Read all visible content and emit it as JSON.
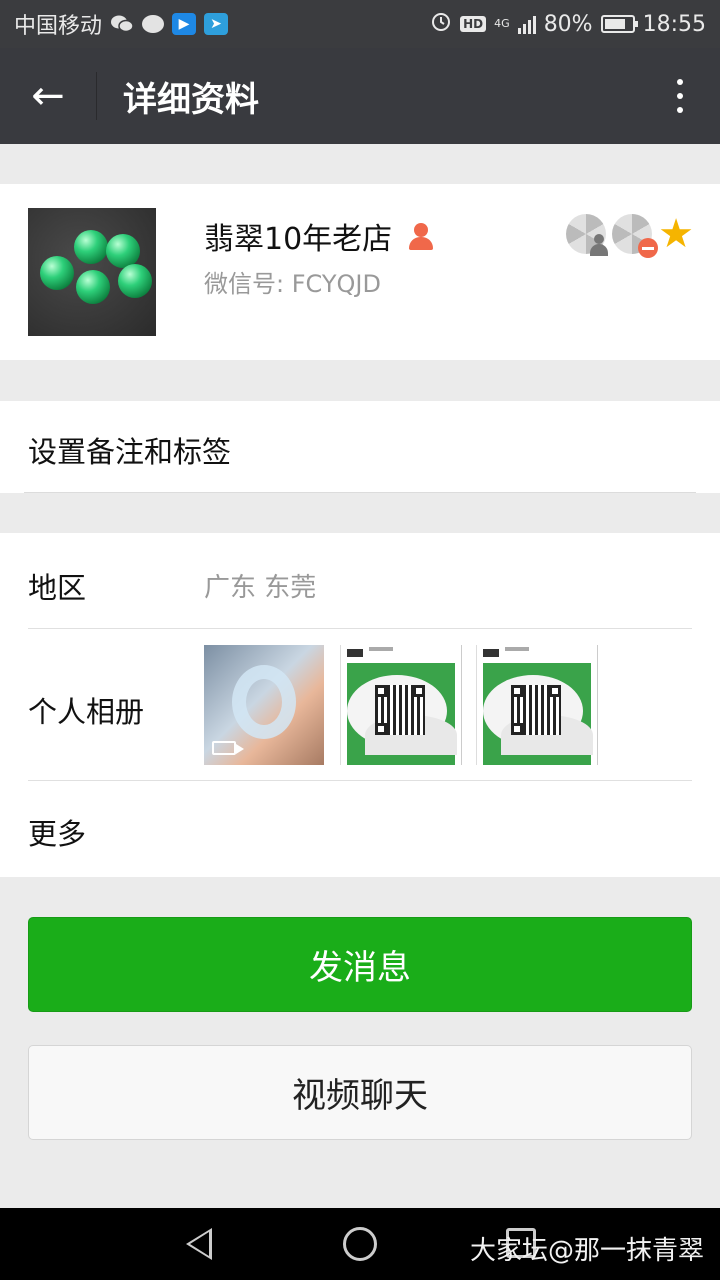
{
  "status_bar": {
    "carrier": "中国移动",
    "network": "4G",
    "battery": "80%",
    "battery_level": 0.8,
    "time": "18:55",
    "hd_label": "HD",
    "icons": [
      "wechat-icon",
      "message-bubble-icon",
      "video-app-icon",
      "navigation-app-icon",
      "alarm-icon",
      "hd-icon",
      "signal-icon",
      "battery-icon"
    ]
  },
  "header": {
    "title": "详细资料",
    "back_icon": "←"
  },
  "profile": {
    "nickname": "翡翠10年老店",
    "wechat_id": "微信号: FCYQJD",
    "status_icons": [
      "moments-hidden-icon",
      "moments-blocked-icon",
      "star-friend-icon"
    ],
    "star_color": "#f5b400"
  },
  "remark": {
    "label": "设置备注和标签"
  },
  "info": {
    "region_label": "地区",
    "region_value": "广东  东莞",
    "album_label": "个人相册",
    "more_label": "更多"
  },
  "actions": {
    "send_message": "发消息",
    "video_chat": "视频聊天",
    "primary_color": "#1aad19"
  },
  "watermark": "大家坛@那一抹青翠"
}
